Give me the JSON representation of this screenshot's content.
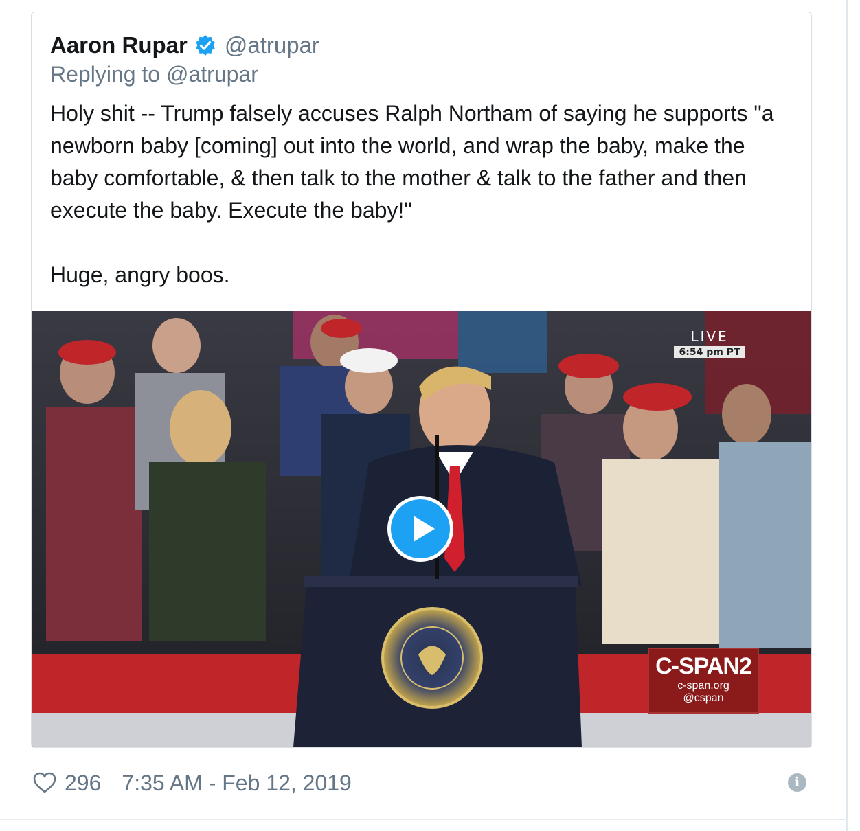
{
  "tweet": {
    "display_name": "Aaron Rupar",
    "handle": "@atrupar",
    "reply_prefix": "Replying to",
    "reply_to": "@atrupar",
    "text": "Holy shit -- Trump falsely accuses Ralph Northam of saying he supports \"a newborn baby [coming] out into the world, and wrap the baby, make the baby comfortable, & then talk to the mother & talk to the father and then execute the baby. Execute the baby!\"\n\nHuge, angry boos.",
    "likes": "296",
    "timestamp": "7:35 AM - Feb 12, 2019",
    "verified_icon": "verified-badge-icon",
    "like_icon": "heart-icon",
    "info_icon": "info-icon"
  },
  "video": {
    "live_label": "LIVE",
    "live_time": "6:54 pm PT",
    "network": "C-SPAN2",
    "network_url": "c-span.org",
    "network_handle": "@cspan",
    "play_icon": "play-icon"
  },
  "colors": {
    "accent": "#1da1f2",
    "muted": "#657786",
    "text": "#14171a",
    "cspan_red": "#8b1a1a"
  }
}
